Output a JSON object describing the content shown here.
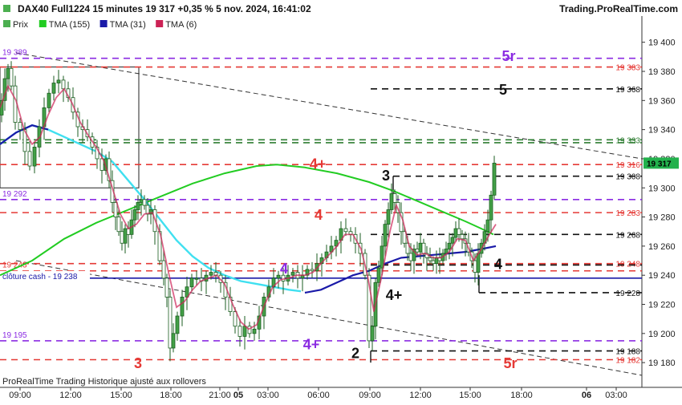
{
  "header": {
    "title": "DAX40 Full1224 15 minutes 19 317 +0,35 % 5 nov. 2024, 16:41:02",
    "site": "Trading.ProRealTime.com"
  },
  "legend": [
    {
      "label": "Prix",
      "color": "#4caf50"
    },
    {
      "label": "TMA (155)",
      "color": "#22cc22"
    },
    {
      "label": "TMA (31)",
      "color": "#1a1aa8"
    },
    {
      "label": "TMA (6)",
      "color": "#cc2255"
    }
  ],
  "footer": {
    "note": "ProRealTime Trading Historique ajusté aux rollovers"
  },
  "chart_data": {
    "type": "candlestick",
    "ylim": [
      19163,
      19418
    ],
    "y_ticks": [
      19180,
      19200,
      19220,
      19240,
      19260,
      19280,
      19300,
      19320,
      19340,
      19360,
      19380,
      19400
    ],
    "y_tick_labels": [
      "19 180",
      "19 200",
      "19 220",
      "19 240",
      "19 260",
      "19 280",
      "19 300",
      "19 320",
      "19 340",
      "19 360",
      "19 380",
      "19 400"
    ],
    "x_ticks": [
      {
        "label": "09:00",
        "bold": false
      },
      {
        "label": "12:00",
        "bold": false
      },
      {
        "label": "15:00",
        "bold": false
      },
      {
        "label": "18:00",
        "bold": false
      },
      {
        "label": "21:00",
        "bold": false
      },
      {
        "label": "05",
        "bold": true
      },
      {
        "label": "03:00",
        "bold": false
      },
      {
        "label": "06:00",
        "bold": false
      },
      {
        "label": "09:00",
        "bold": false
      },
      {
        "label": "12:00",
        "bold": false
      },
      {
        "label": "15:00",
        "bold": false
      },
      {
        "label": "18:00",
        "bold": false
      },
      {
        "label": "06",
        "bold": true
      },
      {
        "label": "03:00",
        "bold": false
      }
    ],
    "last_price": {
      "value": 19317,
      "label": "19 317",
      "color": "#22b14c"
    },
    "hlines": [
      {
        "y": 19389,
        "color": "#8b2be2",
        "label": "19 389",
        "label_side": "left"
      },
      {
        "y": 19383,
        "color": "#e53935",
        "label": "19 383",
        "label_side": "right"
      },
      {
        "y": 19368,
        "color": "#111111",
        "label": "19 368",
        "label_side": "right"
      },
      {
        "y": 19333,
        "color": "#2e7d32",
        "label": "19 333",
        "label_side": "right"
      },
      {
        "y": 19331,
        "color": "#2e7d32",
        "label": "",
        "label_side": "right"
      },
      {
        "y": 19316,
        "color": "#e53935",
        "label": "19 316",
        "label_side": "right"
      },
      {
        "y": 19308,
        "color": "#111111",
        "label": "19 308",
        "label_side": "right"
      },
      {
        "y": 19292,
        "color": "#8b2be2",
        "label": "19 292",
        "label_side": "left"
      },
      {
        "y": 19283,
        "color": "#e53935",
        "label": "19 283",
        "label_side": "right"
      },
      {
        "y": 19268,
        "color": "#111111",
        "label": "19 268",
        "label_side": "right"
      },
      {
        "y": 19248,
        "color": "#e53935",
        "label": "19 248",
        "label_side": "right"
      },
      {
        "y": 19247,
        "color": "#111111",
        "label": "",
        "label_side": "right"
      },
      {
        "y": 19243,
        "color": "#e53935",
        "label": "19 243",
        "label_side": "left"
      },
      {
        "y": 19228,
        "color": "#111111",
        "label": "19 228",
        "label_side": "right"
      },
      {
        "y": 19195,
        "color": "#8b2be2",
        "label": "19 195",
        "label_side": "left"
      },
      {
        "y": 19188,
        "color": "#111111",
        "label": "19 188",
        "label_side": "right"
      },
      {
        "y": 19182,
        "color": "#e53935",
        "label": "19 182",
        "label_side": "right"
      }
    ],
    "cash_close": {
      "y": 19238,
      "label": "clôture cash - 19 238",
      "color": "#1a1aa8"
    },
    "annotations": [
      {
        "text": "5r",
        "y": 19391,
        "color": "#8b2be2"
      },
      {
        "text": "5",
        "y": 19368,
        "color": "#111111"
      },
      {
        "text": "4+",
        "y": 19317,
        "color": "#e53935"
      },
      {
        "text": "3",
        "y": 19309,
        "color": "#111111"
      },
      {
        "text": "4",
        "y": 19282,
        "color": "#e53935"
      },
      {
        "text": "4",
        "y": 19248,
        "color": "#111111"
      },
      {
        "text": "4",
        "y": 19245,
        "color": "#8b2be2"
      },
      {
        "text": "4+",
        "y": 19227,
        "color": "#111111"
      },
      {
        "text": "4+",
        "y": 19193,
        "color": "#8b2be2"
      },
      {
        "text": "2",
        "y": 19187,
        "color": "#111111"
      },
      {
        "text": "5r",
        "y": 19180,
        "color": "#e53935"
      },
      {
        "text": "3",
        "y": 19180,
        "color": "#e53935"
      }
    ],
    "price_path": [
      [
        0,
        19350
      ],
      [
        4,
        19360
      ],
      [
        8,
        19375
      ],
      [
        12,
        19382
      ],
      [
        16,
        19370
      ],
      [
        22,
        19345
      ],
      [
        28,
        19340
      ],
      [
        34,
        19325
      ],
      [
        40,
        19315
      ],
      [
        46,
        19328
      ],
      [
        52,
        19342
      ],
      [
        58,
        19355
      ],
      [
        64,
        19365
      ],
      [
        70,
        19372
      ],
      [
        76,
        19374
      ],
      [
        82,
        19368
      ],
      [
        88,
        19362
      ],
      [
        94,
        19352
      ],
      [
        100,
        19342
      ],
      [
        106,
        19340
      ],
      [
        112,
        19335
      ],
      [
        118,
        19328
      ],
      [
        124,
        19320
      ],
      [
        130,
        19312
      ],
      [
        134,
        19320
      ],
      [
        138,
        19305
      ],
      [
        142,
        19290
      ],
      [
        146,
        19280
      ],
      [
        150,
        19270
      ],
      [
        154,
        19262
      ],
      [
        158,
        19272
      ],
      [
        162,
        19268
      ],
      [
        166,
        19278
      ],
      [
        170,
        19285
      ],
      [
        174,
        19290
      ],
      [
        178,
        19292
      ],
      [
        182,
        19288
      ],
      [
        186,
        19282
      ],
      [
        190,
        19285
      ],
      [
        196,
        19270
      ],
      [
        202,
        19250
      ],
      [
        206,
        19238
      ],
      [
        210,
        19225
      ],
      [
        214,
        19190
      ],
      [
        218,
        19200
      ],
      [
        224,
        19212
      ],
      [
        230,
        19225
      ],
      [
        236,
        19232
      ],
      [
        242,
        19238
      ],
      [
        248,
        19238
      ],
      [
        254,
        19236
      ],
      [
        260,
        19240
      ],
      [
        266,
        19242
      ],
      [
        272,
        19240
      ],
      [
        278,
        19235
      ],
      [
        284,
        19225
      ],
      [
        290,
        19215
      ],
      [
        296,
        19205
      ],
      [
        302,
        19198
      ],
      [
        308,
        19205
      ],
      [
        314,
        19200
      ],
      [
        320,
        19203
      ],
      [
        326,
        19212
      ],
      [
        332,
        19225
      ],
      [
        338,
        19232
      ],
      [
        344,
        19238
      ],
      [
        350,
        19240
      ],
      [
        356,
        19236
      ],
      [
        362,
        19240
      ],
      [
        368,
        19242
      ],
      [
        374,
        19238
      ],
      [
        380,
        19240
      ],
      [
        386,
        19244
      ],
      [
        392,
        19243
      ],
      [
        398,
        19248
      ],
      [
        404,
        19252
      ],
      [
        410,
        19256
      ],
      [
        416,
        19260
      ],
      [
        422,
        19264
      ],
      [
        428,
        19272
      ],
      [
        434,
        19270
      ],
      [
        440,
        19268
      ],
      [
        446,
        19262
      ],
      [
        452,
        19255
      ],
      [
        458,
        19240
      ],
      [
        462,
        19195
      ],
      [
        466,
        19205
      ],
      [
        470,
        19235
      ],
      [
        474,
        19245
      ],
      [
        478,
        19260
      ],
      [
        482,
        19275
      ],
      [
        486,
        19285
      ],
      [
        490,
        19296
      ],
      [
        494,
        19290
      ],
      [
        498,
        19283
      ],
      [
        502,
        19270
      ],
      [
        506,
        19262
      ],
      [
        510,
        19255
      ],
      [
        514,
        19250
      ],
      [
        518,
        19258
      ],
      [
        522,
        19256
      ],
      [
        526,
        19262
      ],
      [
        530,
        19255
      ],
      [
        534,
        19252
      ],
      [
        538,
        19250
      ],
      [
        542,
        19248
      ],
      [
        546,
        19252
      ],
      [
        550,
        19250
      ],
      [
        554,
        19255
      ],
      [
        558,
        19258
      ],
      [
        562,
        19262
      ],
      [
        566,
        19266
      ],
      [
        570,
        19272
      ],
      [
        574,
        19268
      ],
      [
        578,
        19265
      ],
      [
        582,
        19262
      ],
      [
        586,
        19256
      ],
      [
        590,
        19250
      ],
      [
        594,
        19242
      ],
      [
        598,
        19255
      ],
      [
        602,
        19262
      ],
      [
        606,
        19270
      ],
      [
        610,
        19278
      ],
      [
        614,
        19295
      ],
      [
        618,
        19317
      ]
    ],
    "tma155": [
      [
        0,
        19240
      ],
      [
        40,
        19250
      ],
      [
        80,
        19265
      ],
      [
        120,
        19276
      ],
      [
        160,
        19285
      ],
      [
        200,
        19294
      ],
      [
        240,
        19303
      ],
      [
        280,
        19310
      ],
      [
        320,
        19315
      ],
      [
        345,
        19316
      ],
      [
        380,
        19314
      ],
      [
        420,
        19310
      ],
      [
        460,
        19304
      ],
      [
        490,
        19298
      ],
      [
        520,
        19291
      ],
      [
        550,
        19284
      ],
      [
        580,
        19277
      ],
      [
        600,
        19272
      ],
      [
        615,
        19268
      ]
    ],
    "tma31": [
      [
        0,
        19330
      ],
      [
        20,
        19338
      ],
      [
        40,
        19343
      ],
      [
        60,
        19340
      ],
      [
        80,
        19335
      ],
      [
        100,
        19330
      ],
      [
        120,
        19325
      ],
      [
        140,
        19318
      ],
      [
        160,
        19305
      ],
      [
        180,
        19292
      ],
      [
        200,
        19278
      ],
      [
        220,
        19264
      ],
      [
        240,
        19253
      ],
      [
        260,
        19245
      ],
      [
        280,
        19240
      ],
      [
        300,
        19236
      ],
      [
        320,
        19234
      ],
      [
        340,
        19232
      ],
      [
        360,
        19230
      ],
      [
        380,
        19228
      ],
      [
        400,
        19230
      ],
      [
        420,
        19235
      ],
      [
        440,
        19240
      ],
      [
        460,
        19243
      ],
      [
        480,
        19248
      ],
      [
        500,
        19252
      ],
      [
        520,
        19253
      ],
      [
        540,
        19254
      ],
      [
        560,
        19255
      ],
      [
        580,
        19256
      ],
      [
        600,
        19258
      ],
      [
        618,
        19260
      ]
    ],
    "tma6": [
      [
        0,
        19355
      ],
      [
        10,
        19370
      ],
      [
        20,
        19360
      ],
      [
        30,
        19340
      ],
      [
        40,
        19330
      ],
      [
        50,
        19335
      ],
      [
        60,
        19350
      ],
      [
        70,
        19362
      ],
      [
        80,
        19368
      ],
      [
        90,
        19358
      ],
      [
        100,
        19345
      ],
      [
        110,
        19336
      ],
      [
        120,
        19328
      ],
      [
        130,
        19318
      ],
      [
        140,
        19300
      ],
      [
        150,
        19282
      ],
      [
        160,
        19272
      ],
      [
        170,
        19275
      ],
      [
        180,
        19282
      ],
      [
        190,
        19283
      ],
      [
        200,
        19268
      ],
      [
        210,
        19242
      ],
      [
        220,
        19218
      ],
      [
        230,
        19222
      ],
      [
        240,
        19230
      ],
      [
        250,
        19236
      ],
      [
        260,
        19238
      ],
      [
        270,
        19240
      ],
      [
        280,
        19234
      ],
      [
        290,
        19220
      ],
      [
        300,
        19208
      ],
      [
        310,
        19203
      ],
      [
        320,
        19206
      ],
      [
        330,
        19220
      ],
      [
        340,
        19232
      ],
      [
        350,
        19237
      ],
      [
        360,
        19238
      ],
      [
        370,
        19240
      ],
      [
        380,
        19240
      ],
      [
        390,
        19242
      ],
      [
        400,
        19248
      ],
      [
        410,
        19254
      ],
      [
        420,
        19260
      ],
      [
        430,
        19268
      ],
      [
        440,
        19268
      ],
      [
        450,
        19258
      ],
      [
        458,
        19240
      ],
      [
        466,
        19215
      ],
      [
        476,
        19240
      ],
      [
        486,
        19270
      ],
      [
        494,
        19288
      ],
      [
        502,
        19278
      ],
      [
        510,
        19260
      ],
      [
        520,
        19254
      ],
      [
        530,
        19255
      ],
      [
        540,
        19252
      ],
      [
        550,
        19252
      ],
      [
        560,
        19256
      ],
      [
        570,
        19265
      ],
      [
        580,
        19264
      ],
      [
        590,
        19250
      ],
      [
        600,
        19258
      ],
      [
        610,
        19268
      ],
      [
        618,
        19275
      ]
    ],
    "tma31_color": "#1a1aa8",
    "tma155_color": "#22cc22",
    "tma6_color": "#cc2255",
    "cyan_color": "#40e0f0",
    "cyan_curve": [
      [
        0,
        19330
      ],
      [
        20,
        19338
      ],
      [
        40,
        19343
      ],
      [
        60,
        19340
      ],
      [
        80,
        19335
      ],
      [
        100,
        19330
      ],
      [
        120,
        19325
      ],
      [
        140,
        19318
      ],
      [
        160,
        19305
      ],
      [
        180,
        19292
      ],
      [
        200,
        19278
      ],
      [
        220,
        19264
      ],
      [
        240,
        19253
      ],
      [
        260,
        19245
      ],
      [
        280,
        19240
      ],
      [
        300,
        19236
      ],
      [
        320,
        19234
      ],
      [
        340,
        19232
      ],
      [
        360,
        19230
      ],
      [
        375,
        19229
      ]
    ]
  }
}
